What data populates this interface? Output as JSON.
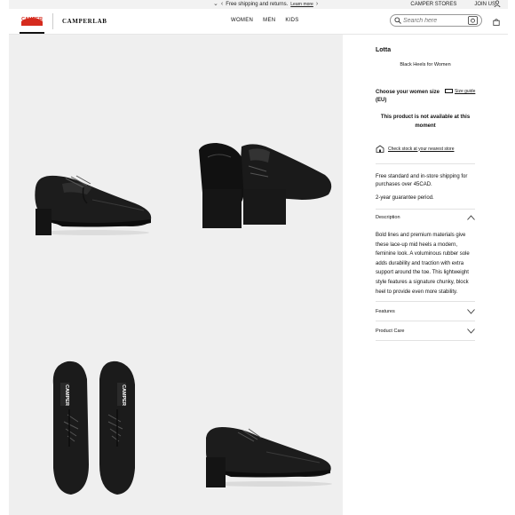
{
  "topbar": {
    "promo_text": "Free shipping and returns.",
    "promo_link": "Learn more",
    "stores": "CAMPER STORES",
    "join": "JOIN US"
  },
  "header": {
    "logo_text": "CAMPER",
    "camperlab": "CAMPERLAB",
    "nav": [
      "WOMEN",
      "MEN",
      "KIDS"
    ],
    "search_placeholder": "Search here"
  },
  "product": {
    "name": "Lotta",
    "category": "Black Heels for Women",
    "size_label": "Choose your women size (EU)",
    "size_guide": "Size guide",
    "unavailable": "This product is not available at this moment",
    "check_stock": "Check stock at your nearest store",
    "shipping": "Free standard and in-store shipping for purchases over 45CAD.",
    "guarantee": "2-year guarantee period.",
    "accordion": {
      "description": "Description",
      "features": "Features",
      "product_care": "Product Care"
    },
    "description_text": "Bold lines and premium materials give these lace-up mid heels a modern, feminine look. A voluminous rubber sole adds durability and traction with extra support around the toe. This lightweight style features a signature chunky, block heel to provide even more stability."
  },
  "colors": {
    "brand_red": "#d52b1e",
    "gallery_bg": "#efefef"
  }
}
